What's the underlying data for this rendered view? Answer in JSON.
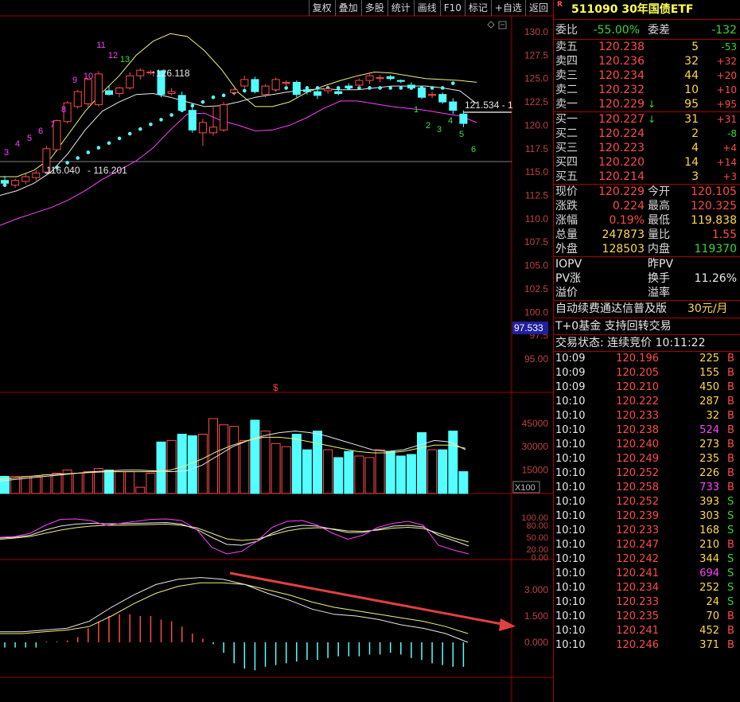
{
  "toolbar": {
    "buttons": [
      "复权",
      "叠加",
      "多股",
      "统计",
      "画线",
      "F10",
      "标记",
      "+自选",
      "返回"
    ]
  },
  "colors": {
    "up": "#ff4a4a",
    "down": "#54ffff",
    "ma_yellow": "#f0f080",
    "ma_white": "#e8e8e8",
    "ma_magenta": "#ff40ff",
    "grid": "#a00000",
    "arrow": "#e04040"
  },
  "chart": {
    "price_axis": [
      "130.0",
      "127.5",
      "125.0",
      "122.5",
      "120.0",
      "117.5",
      "115.0",
      "112.5",
      "110.0",
      "107.5",
      "105.0",
      "102.5",
      "100.0",
      "97.5",
      "95.00"
    ],
    "price_tag": "97.533",
    "high_label": "126.118",
    "low_label_1": "116.040",
    "low_label_2": "116.201",
    "current_label": "121.534 - 1",
    "s_marker": "$",
    "td_up_counts": [
      "3",
      "4",
      "5",
      "6",
      "7",
      "8",
      "9",
      "10",
      "11",
      "12",
      "13"
    ],
    "td_down_counts": [
      "1",
      "2",
      "3",
      "4",
      "5",
      "6"
    ],
    "volume_axis": [
      "45000",
      "30000",
      "15000"
    ],
    "volume_unit": "X100",
    "kdj_axis": [
      "100.00",
      "80.00",
      "50.00",
      "20.00",
      "0.00"
    ],
    "macd_axis": [
      "3.000",
      "1.500",
      "0.000"
    ]
  },
  "quote": {
    "logo": "R",
    "title": "511090 30年国债ETF",
    "ratio_label": "委比",
    "ratio_value": "-55.00%",
    "diff_label": "委差",
    "diff_value": "-132",
    "sells": [
      {
        "label": "卖五",
        "price": "120.238",
        "vol": "5",
        "chg": "-53"
      },
      {
        "label": "卖四",
        "price": "120.236",
        "vol": "32",
        "chg": "+32"
      },
      {
        "label": "卖三",
        "price": "120.234",
        "vol": "44",
        "chg": "+20"
      },
      {
        "label": "卖二",
        "price": "120.232",
        "vol": "10",
        "chg": "+10"
      },
      {
        "label": "卖一",
        "price": "120.229",
        "vol": "95",
        "chg": "+95"
      }
    ],
    "buys": [
      {
        "label": "买一",
        "price": "120.227",
        "vol": "31",
        "chg": "+31"
      },
      {
        "label": "买二",
        "price": "120.224",
        "vol": "2",
        "chg": "-8"
      },
      {
        "label": "买三",
        "price": "120.223",
        "vol": "4",
        "chg": "+4"
      },
      {
        "label": "买四",
        "price": "120.220",
        "vol": "14",
        "chg": "+14"
      },
      {
        "label": "买五",
        "price": "120.214",
        "vol": "3",
        "chg": "+3"
      }
    ],
    "stats": [
      {
        "l1": "现价",
        "v1": "120.229",
        "l2": "今开",
        "v2": "120.105"
      },
      {
        "l1": "涨跌",
        "v1": "0.224",
        "l2": "最高",
        "v2": "120.325"
      },
      {
        "l1": "涨幅",
        "v1": "0.19%",
        "l2": "最低",
        "v2": "119.838"
      },
      {
        "l1": "总量",
        "v1": "247873",
        "l2": "量比",
        "v2": "1.55"
      },
      {
        "l1": "外盘",
        "v1": "128503",
        "l2": "内盘",
        "v2": "119370"
      }
    ],
    "iopv": {
      "l1": "IOPV",
      "l2": "昨PV",
      "l3": "PV涨",
      "l4": "换手",
      "v4": "11.26%",
      "l5": "溢价",
      "l6": "溢率"
    },
    "promo_text": "自动续费通达信普及版",
    "promo_price": "30元/月",
    "fund_note": "T+0基金 支持回转交易",
    "trade_status": "交易状态: 连续竞价 10:11:22",
    "ticks": [
      {
        "t": "10:09",
        "p": "120.196",
        "v": "225",
        "s": "B"
      },
      {
        "t": "10:09",
        "p": "120.205",
        "v": "155",
        "s": "B"
      },
      {
        "t": "10:09",
        "p": "120.210",
        "v": "450",
        "s": "B"
      },
      {
        "t": "10:10",
        "p": "120.222",
        "v": "287",
        "s": "B"
      },
      {
        "t": "10:10",
        "p": "120.233",
        "v": "32",
        "s": "B"
      },
      {
        "t": "10:10",
        "p": "120.238",
        "v": "524",
        "s": "B"
      },
      {
        "t": "10:10",
        "p": "120.240",
        "v": "273",
        "s": "B"
      },
      {
        "t": "10:10",
        "p": "120.249",
        "v": "235",
        "s": "B"
      },
      {
        "t": "10:10",
        "p": "120.252",
        "v": "226",
        "s": "B"
      },
      {
        "t": "10:10",
        "p": "120.258",
        "v": "733",
        "s": "B"
      },
      {
        "t": "10:10",
        "p": "120.252",
        "v": "393",
        "s": "S"
      },
      {
        "t": "10:10",
        "p": "120.239",
        "v": "303",
        "s": "S"
      },
      {
        "t": "10:10",
        "p": "120.233",
        "v": "168",
        "s": "S"
      },
      {
        "t": "10:10",
        "p": "120.247",
        "v": "210",
        "s": "B"
      },
      {
        "t": "10:10",
        "p": "120.242",
        "v": "344",
        "s": "S"
      },
      {
        "t": "10:10",
        "p": "120.241",
        "v": "694",
        "s": "S"
      },
      {
        "t": "10:10",
        "p": "120.234",
        "v": "252",
        "s": "S"
      },
      {
        "t": "10:10",
        "p": "120.233",
        "v": "24",
        "s": "S"
      },
      {
        "t": "10:10",
        "p": "120.235",
        "v": "70",
        "s": "B"
      },
      {
        "t": "10:10",
        "p": "120.241",
        "v": "452",
        "s": "B"
      },
      {
        "t": "10:10",
        "p": "120.246",
        "v": "371",
        "s": "B"
      }
    ]
  },
  "chart_data": {
    "type": "candlestick",
    "price_ylim": [
      95,
      130
    ],
    "candles": [
      {
        "o": 114.1,
        "h": 114.6,
        "l": 113.5,
        "c": 113.8
      },
      {
        "o": 113.6,
        "h": 114.3,
        "l": 113.3,
        "c": 114.1
      },
      {
        "o": 114.0,
        "h": 114.8,
        "l": 113.7,
        "c": 114.5
      },
      {
        "o": 114.4,
        "h": 115.2,
        "l": 114.1,
        "c": 114.9
      },
      {
        "o": 115.0,
        "h": 117.8,
        "l": 114.9,
        "c": 117.5
      },
      {
        "o": 117.4,
        "h": 120.6,
        "l": 117.2,
        "c": 120.5
      },
      {
        "o": 120.4,
        "h": 122.6,
        "l": 120.2,
        "c": 122.4
      },
      {
        "o": 122.0,
        "h": 123.8,
        "l": 121.8,
        "c": 123.6
      },
      {
        "o": 122.3,
        "h": 125.0,
        "l": 121.9,
        "c": 124.9
      },
      {
        "o": 122.2,
        "h": 125.8,
        "l": 122.0,
        "c": 125.5
      },
      {
        "o": 123.7,
        "h": 124.2,
        "l": 123.2,
        "c": 123.3
      },
      {
        "o": 123.4,
        "h": 124.1,
        "l": 123.0,
        "c": 124.0
      },
      {
        "o": 124.0,
        "h": 125.7,
        "l": 123.8,
        "c": 125.3
      },
      {
        "o": 125.3,
        "h": 126.1,
        "l": 124.9,
        "c": 125.9
      },
      {
        "o": 125.6,
        "h": 125.9,
        "l": 125.4,
        "c": 125.7
      },
      {
        "o": 125.8,
        "h": 125.9,
        "l": 123.0,
        "c": 123.3
      },
      {
        "o": 123.4,
        "h": 124.0,
        "l": 123.2,
        "c": 123.6
      },
      {
        "o": 123.2,
        "h": 123.6,
        "l": 121.4,
        "c": 121.6
      },
      {
        "o": 121.6,
        "h": 122.0,
        "l": 119.2,
        "c": 119.5
      },
      {
        "o": 119.2,
        "h": 120.7,
        "l": 117.8,
        "c": 120.3
      },
      {
        "o": 119.2,
        "h": 122.1,
        "l": 118.9,
        "c": 119.8
      },
      {
        "o": 119.5,
        "h": 122.5,
        "l": 119.3,
        "c": 122.2
      },
      {
        "o": 123.5,
        "h": 124.0,
        "l": 123.2,
        "c": 123.8
      },
      {
        "o": 124.2,
        "h": 125.3,
        "l": 123.9,
        "c": 124.9
      },
      {
        "o": 124.9,
        "h": 125.2,
        "l": 123.4,
        "c": 123.6
      },
      {
        "o": 123.3,
        "h": 124.4,
        "l": 123.0,
        "c": 124.2
      },
      {
        "o": 123.8,
        "h": 125.1,
        "l": 123.6,
        "c": 124.9
      },
      {
        "o": 124.5,
        "h": 124.8,
        "l": 124.1,
        "c": 124.6
      },
      {
        "o": 124.6,
        "h": 124.8,
        "l": 123.0,
        "c": 123.3
      },
      {
        "o": 123.8,
        "h": 124.1,
        "l": 123.3,
        "c": 123.6
      },
      {
        "o": 123.6,
        "h": 123.8,
        "l": 122.8,
        "c": 123.2
      },
      {
        "o": 123.7,
        "h": 124.1,
        "l": 123.4,
        "c": 123.9
      },
      {
        "o": 123.6,
        "h": 124.0,
        "l": 123.2,
        "c": 123.4
      },
      {
        "o": 124.2,
        "h": 124.5,
        "l": 123.9,
        "c": 124.0
      },
      {
        "o": 124.3,
        "h": 125.0,
        "l": 124.0,
        "c": 124.8
      },
      {
        "o": 124.8,
        "h": 125.7,
        "l": 124.4,
        "c": 125.3
      },
      {
        "o": 125.0,
        "h": 125.4,
        "l": 124.6,
        "c": 125.1
      },
      {
        "o": 125.2,
        "h": 125.4,
        "l": 124.8,
        "c": 125.0
      },
      {
        "o": 124.8,
        "h": 124.9,
        "l": 124.5,
        "c": 124.7
      },
      {
        "o": 124.3,
        "h": 124.6,
        "l": 123.8,
        "c": 124.0
      },
      {
        "o": 124.0,
        "h": 124.2,
        "l": 122.8,
        "c": 123.0
      },
      {
        "o": 123.2,
        "h": 123.6,
        "l": 122.9,
        "c": 123.3
      },
      {
        "o": 123.3,
        "h": 123.5,
        "l": 122.3,
        "c": 122.5
      },
      {
        "o": 122.5,
        "h": 122.9,
        "l": 121.2,
        "c": 121.6
      },
      {
        "o": 121.2,
        "h": 121.6,
        "l": 119.8,
        "c": 120.2
      }
    ],
    "ma_short": [
      114.5,
      114.5,
      115.2,
      116.5,
      119.0,
      121.5,
      123.5,
      125.3,
      127.5,
      129.0,
      129.8,
      129.5,
      128.0,
      126.0,
      123.5,
      122.0,
      122.0,
      122.5,
      123.5,
      124.2,
      124.8,
      125.3,
      125.7,
      125.6,
      125.3,
      125.0,
      124.9,
      124.8,
      124.6
    ],
    "ma_mid": [
      112.5,
      113.0,
      113.8,
      115.0,
      117.0,
      119.5,
      121.5,
      122.5,
      123.3,
      123.4,
      123.0,
      122.5,
      122.0,
      122.1,
      122.5,
      123.0,
      123.3,
      123.6,
      123.8,
      123.9,
      123.8,
      123.8,
      124.0,
      124.2,
      124.2,
      124.2,
      124.0,
      123.7,
      122.3
    ],
    "ma_long": [
      109.3,
      110.0,
      110.6,
      111.2,
      112.0,
      113.0,
      114.2,
      115.2,
      116.2,
      117.6,
      119.5,
      121.2,
      121.3,
      120.5,
      120.0,
      119.4,
      119.5,
      120.0,
      120.8,
      121.8,
      122.6,
      122.6,
      122.3,
      122.0,
      121.8,
      121.6,
      121.3,
      121.0,
      120.3
    ],
    "sar": [
      113.6,
      113.9,
      114.2,
      114.6,
      115.0,
      115.5,
      116.0,
      116.5,
      117.1,
      117.6,
      118.1,
      118.6,
      119.1,
      119.6,
      120.1,
      120.6,
      121.1,
      121.6,
      122.1,
      122.5,
      123.0,
      123.2,
      123.5,
      123.7,
      123.8,
      123.9,
      123.9,
      124.0,
      124.0,
      124.0,
      124.0,
      124.0,
      124.0,
      124.0,
      124.0,
      124.0,
      124.0,
      124.0,
      124.0,
      124.0,
      124.0,
      124.0,
      124.0,
      124.5
    ],
    "volume": [
      11000,
      11000,
      11000,
      11000,
      12000,
      13000,
      15000,
      13000,
      14000,
      16000,
      15000,
      14000,
      14000,
      4000,
      13000,
      33000,
      34000,
      38000,
      37000,
      38000,
      48000,
      44000,
      43000,
      34000,
      47000,
      40000,
      32000,
      30000,
      38000,
      28000,
      40000,
      28000,
      23000,
      27000,
      24000,
      23000,
      28000,
      27000,
      24000,
      25000,
      39000,
      28000,
      28000,
      40000,
      14000
    ],
    "vol_ma1": [
      8000,
      9000,
      10000,
      11000,
      12000,
      13000,
      14000,
      14500,
      15000,
      15000,
      14500,
      14000,
      14500,
      18000,
      24000,
      30000,
      34000,
      37000,
      39000,
      40000,
      39000,
      37000,
      34000,
      31000,
      28000,
      27000,
      28000,
      31000,
      34000,
      33000,
      28000
    ],
    "vol_ma2": [
      9000,
      10000,
      11000,
      12000,
      12500,
      13000,
      13500,
      14000,
      14000,
      14000,
      14000,
      15000,
      18000,
      22000,
      27000,
      31000,
      34000,
      36000,
      36000,
      35000,
      33000,
      31000,
      29000,
      27000,
      26000,
      26000,
      27000,
      29000,
      31000,
      31000,
      29000
    ],
    "kdj_ylim": [
      0,
      110
    ],
    "kdj_k": [
      50,
      52,
      60,
      80,
      95,
      96,
      92,
      80,
      85,
      90,
      95,
      96,
      92,
      70,
      25,
      8,
      15,
      40,
      75,
      90,
      92,
      80,
      60,
      45,
      55,
      75,
      85,
      90,
      80,
      30,
      18,
      8
    ],
    "kdj_d": [
      48,
      50,
      55,
      68,
      78,
      83,
      85,
      84,
      84,
      85,
      86,
      87,
      83,
      70,
      50,
      32,
      30,
      40,
      60,
      75,
      80,
      78,
      70,
      62,
      62,
      70,
      78,
      80,
      76,
      55,
      42,
      28
    ],
    "kdj_j": [
      45,
      48,
      52,
      60,
      68,
      74,
      78,
      80,
      80,
      81,
      82,
      83,
      80,
      74,
      60,
      46,
      42,
      45,
      56,
      66,
      72,
      74,
      71,
      66,
      65,
      68,
      73,
      75,
      72,
      60,
      48,
      38
    ],
    "macd_ylim": [
      -2.5,
      5.5
    ],
    "macd_dif": [
      0.6,
      0.6,
      0.7,
      0.8,
      1.2,
      2.0,
      2.7,
      3.3,
      3.6,
      3.7,
      3.6,
      3.3,
      2.8,
      2.4,
      1.9,
      1.6,
      1.5,
      1.3,
      1.0,
      0.8,
      0.5,
      0.0
    ],
    "macd_dea": [
      0.5,
      0.5,
      0.6,
      0.7,
      0.9,
      1.5,
      2.2,
      2.8,
      3.2,
      3.4,
      3.4,
      3.3,
      3.0,
      2.7,
      2.3,
      2.0,
      1.8,
      1.6,
      1.4,
      1.2,
      0.9,
      0.5
    ],
    "macd_hist": [
      -0.3,
      -0.3,
      -0.3,
      -0.3,
      0.05,
      0.05,
      0.1,
      0.3,
      0.8,
      1.2,
      1.5,
      1.6,
      1.6,
      1.5,
      1.5,
      1.3,
      1.2,
      0.9,
      0.5,
      0.2,
      -0.1,
      -0.6,
      -1.2,
      -1.5,
      -1.6,
      -1.4,
      -1.3,
      -1.2,
      -1.1,
      -1.0,
      -1.0,
      -0.9,
      -0.8,
      -0.8,
      -0.8,
      -0.7,
      -0.7,
      -0.6,
      -0.7,
      -0.9,
      -1.0,
      -1.2,
      -1.3,
      -1.4,
      -1.4
    ]
  }
}
